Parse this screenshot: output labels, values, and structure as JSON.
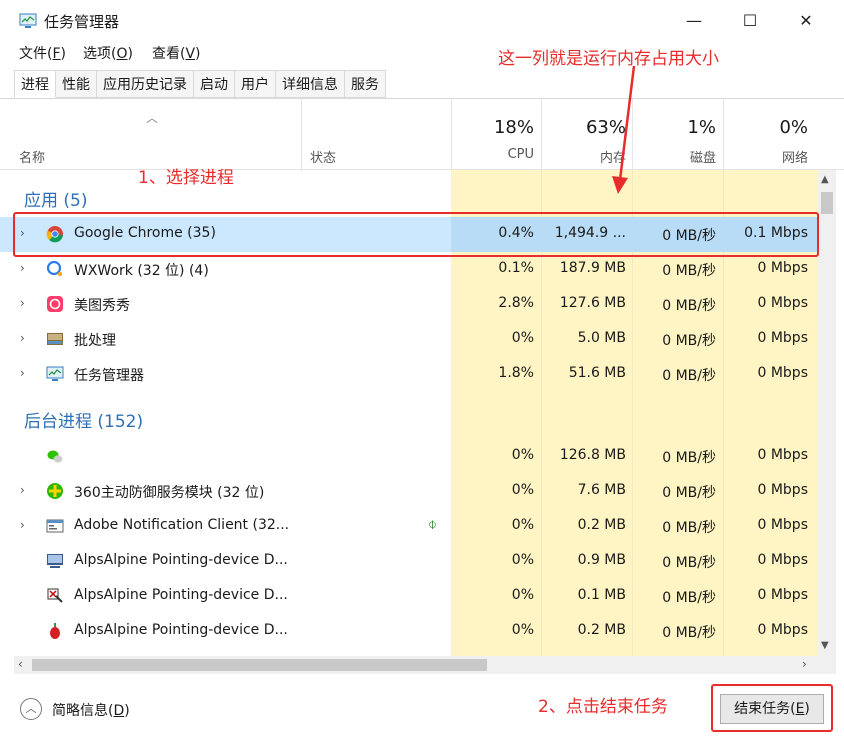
{
  "window": {
    "title": "任务管理器",
    "minimize_glyph": "—",
    "maximize_glyph": "☐",
    "close_glyph": "✕"
  },
  "menu": [
    {
      "label": "文件(F)",
      "pre": "文件(",
      "key": "F",
      "post": ")"
    },
    {
      "label": "选项(O)",
      "pre": "选项(",
      "key": "O",
      "post": ")"
    },
    {
      "label": "查看(V)",
      "pre": "查看(",
      "key": "V",
      "post": ")"
    }
  ],
  "tabs": [
    "进程",
    "性能",
    "应用历史记录",
    "启动",
    "用户",
    "详细信息",
    "服务"
  ],
  "header": {
    "name": "名称",
    "status": "状态",
    "cpu_pct": "18%",
    "cpu": "CPU",
    "mem_pct": "63%",
    "mem": "内存",
    "disk_pct": "1%",
    "disk": "磁盘",
    "net_pct": "0%",
    "net": "网络"
  },
  "groups": {
    "apps": "应用 (5)",
    "background": "后台进程 (152)"
  },
  "apps": [
    {
      "name": "Google Chrome (35)",
      "cpu": "0.4%",
      "mem": "1,494.9 ...",
      "disk": "0 MB/秒",
      "net": "0.1 Mbps",
      "icon": "chrome-icon"
    },
    {
      "name": "WXWork (32 位) (4)",
      "cpu": "0.1%",
      "mem": "187.9 MB",
      "disk": "0 MB/秒",
      "net": "0 Mbps",
      "icon": "wxwork-icon"
    },
    {
      "name": "美图秀秀",
      "cpu": "2.8%",
      "mem": "127.6 MB",
      "disk": "0 MB/秒",
      "net": "0 Mbps",
      "icon": "meitu-icon"
    },
    {
      "name": "批处理",
      "cpu": "0%",
      "mem": "5.0 MB",
      "disk": "0 MB/秒",
      "net": "0 Mbps",
      "icon": "batch-icon"
    },
    {
      "name": "任务管理器",
      "cpu": "1.8%",
      "mem": "51.6 MB",
      "disk": "0 MB/秒",
      "net": "0 Mbps",
      "icon": "taskmgr-icon"
    }
  ],
  "background": [
    {
      "name": "",
      "cpu": "0%",
      "mem": "126.8 MB",
      "disk": "0 MB/秒",
      "net": "0 Mbps",
      "icon": "wechat-icon"
    },
    {
      "name": "360主动防御服务模块 (32 位)",
      "cpu": "0%",
      "mem": "7.6 MB",
      "disk": "0 MB/秒",
      "net": "0 Mbps",
      "icon": "360-icon"
    },
    {
      "name": "Adobe Notification Client (32...",
      "cpu": "0%",
      "mem": "0.2 MB",
      "disk": "0 MB/秒",
      "net": "0 Mbps",
      "icon": "adobe-icon"
    },
    {
      "name": "AlpsAlpine Pointing-device D...",
      "cpu": "0%",
      "mem": "0.9 MB",
      "disk": "0 MB/秒",
      "net": "0 Mbps",
      "icon": "alps-icon"
    },
    {
      "name": "AlpsAlpine Pointing-device D...",
      "cpu": "0%",
      "mem": "0.1 MB",
      "disk": "0 MB/秒",
      "net": "0 Mbps",
      "icon": "alps-icon"
    },
    {
      "name": "AlpsAlpine Pointing-device D...",
      "cpu": "0%",
      "mem": "0.2 MB",
      "disk": "0 MB/秒",
      "net": "0 Mbps",
      "icon": "alps-icon"
    }
  ],
  "footer": {
    "fewer_details": "简略信息(D)",
    "fewer_pre": "简略信息(",
    "fewer_key": "D",
    "fewer_post": ")",
    "end_task": "结束任务(E)",
    "end_pre": "结束任务(",
    "end_key": "E",
    "end_post": ")"
  },
  "annotations": {
    "memory_column_note": "这一列就是运行内存占用大小",
    "step1": "1、选择进程",
    "step2": "2、点击结束任务"
  },
  "colors": {
    "annotation": "#e82c2c",
    "group_title": "#2f6fb5",
    "heat": "#fff4c4",
    "selected_row": "#cce8ff"
  }
}
